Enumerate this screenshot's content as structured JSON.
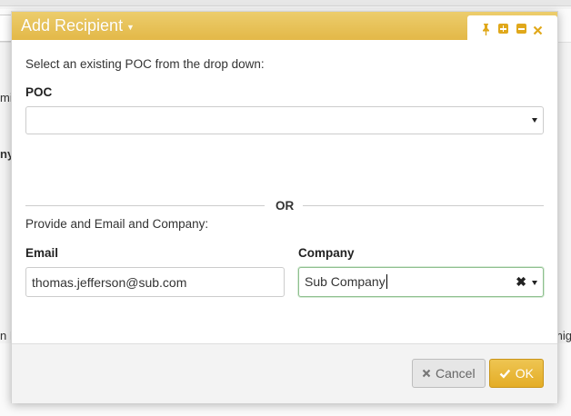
{
  "background": {
    "left_fragment_1": "mi",
    "left_fragment_2": "ny",
    "left_fragment_3": "n N",
    "right_fragment": "mig"
  },
  "dialog": {
    "title": "Add Recipient",
    "title_caret_icon": "caret-down-icon",
    "controls": [
      {
        "name": "pin-icon"
      },
      {
        "name": "maximize-icon"
      },
      {
        "name": "minimize-icon"
      },
      {
        "name": "close-icon"
      }
    ],
    "accent_color": "#e3b848",
    "poc_section": {
      "instruction": "Select an existing POC from the drop down:",
      "label": "POC",
      "value": ""
    },
    "or_text": "OR",
    "manual_section": {
      "instruction": "Provide and Email and Company:",
      "email_label": "Email",
      "email_value": "thomas.jefferson@sub.com",
      "company_label": "Company",
      "company_value": "Sub Company"
    },
    "footer": {
      "cancel_label": "Cancel",
      "ok_label": "OK"
    }
  }
}
